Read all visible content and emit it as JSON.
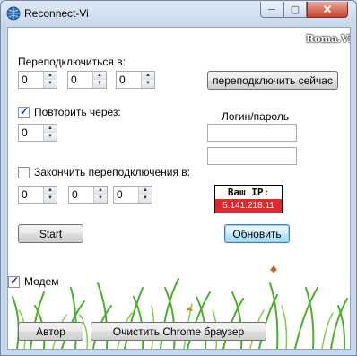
{
  "window": {
    "title": "Reconnect-Vi",
    "controls": {
      "minimize": "─",
      "maximize": "▢",
      "close": "✕"
    }
  },
  "brand": "Roma.Vi",
  "reconnect_at": {
    "label": "Переподключиться в:",
    "values": [
      "0",
      "0",
      "0"
    ]
  },
  "reconnect_now_button": "переподключить сейчас",
  "repeat": {
    "label": "Повторить через:",
    "checked": true,
    "value": "0"
  },
  "credentials": {
    "label": "Логин/пароль",
    "login": "",
    "password": ""
  },
  "finish": {
    "label": "Закончить переподключения в:",
    "checked": false,
    "values": [
      "0",
      "0",
      "0"
    ]
  },
  "ip": {
    "title": "Ваш IP:",
    "value": "5.141.218.11"
  },
  "start_button": "Start",
  "refresh_button": "Обновить",
  "modem": {
    "label": "Модем",
    "checked": true
  },
  "author_button": "Автор",
  "clear_chrome_button": "Очистить Chrome браузер",
  "colors": {
    "ip_red": "#e3262c",
    "grass_green": "#4caf2a",
    "check_blue": "#1a3a8a"
  }
}
